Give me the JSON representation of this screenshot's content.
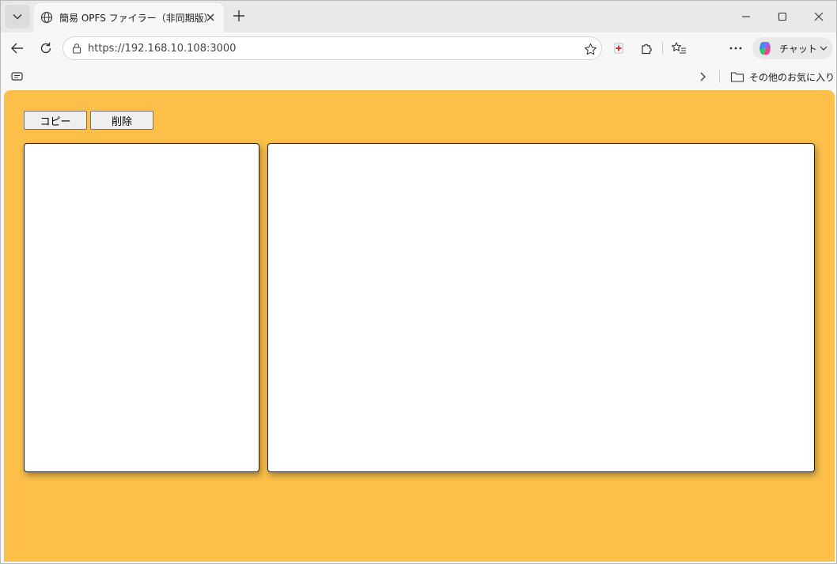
{
  "browser": {
    "tab_title": "簡易 OPFS ファイラー（非同期版）",
    "url": "https://192.168.10.108:3000",
    "copilot_label": "チャット",
    "other_favorites_label": "その他のお気に入り"
  },
  "icons": {
    "tab_list": "chevron-down-icon",
    "tab": "globe-icon",
    "close_tab": "close-icon",
    "new_tab": "plus-icon",
    "minimize": "minimize-icon",
    "maximize": "maximize-icon",
    "close_window": "close-icon",
    "back": "arrow-left-icon",
    "reload": "reload-icon",
    "lock": "lock-icon",
    "favorite": "star-icon",
    "extensions": "puzzle-icon",
    "favorites": "favorites-list-icon",
    "more": "more-icon",
    "copilot": "copilot-logo",
    "favorites_folder": "folder-icon",
    "reading_view": "reading-view-icon"
  },
  "page": {
    "copy_label": "コピー",
    "delete_label": "削除",
    "background_color": "#fbbf4a"
  }
}
